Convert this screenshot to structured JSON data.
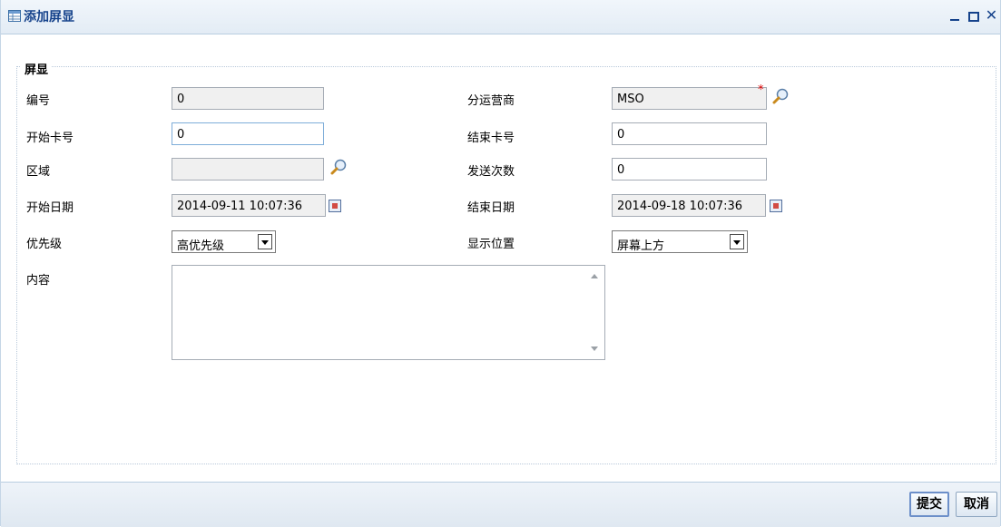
{
  "window": {
    "title": "添加屏显"
  },
  "section": {
    "legend": "屏显"
  },
  "form": {
    "id": {
      "label": "编号",
      "value": "0"
    },
    "operator": {
      "label": "分运营商",
      "value": "MSO",
      "required_mark": "*"
    },
    "start_card": {
      "label": "开始卡号",
      "value": "0"
    },
    "end_card": {
      "label": "结束卡号",
      "value": "0"
    },
    "region": {
      "label": "区域",
      "value": ""
    },
    "send_count": {
      "label": "发送次数",
      "value": "0"
    },
    "start_date": {
      "label": "开始日期",
      "value": "2014-09-11 10:07:36"
    },
    "end_date": {
      "label": "结束日期",
      "value": "2014-09-18 10:07:36"
    },
    "priority": {
      "label": "优先级",
      "value": "高优先级"
    },
    "position": {
      "label": "显示位置",
      "value": "屏幕上方"
    },
    "content": {
      "label": "内容",
      "value": ""
    }
  },
  "buttons": {
    "submit": "提交",
    "cancel": "取消"
  },
  "colors": {
    "title": "#15428b",
    "border": "#a5acb5",
    "readonly_bg": "#f0f0f0",
    "required": "#dd0000"
  }
}
